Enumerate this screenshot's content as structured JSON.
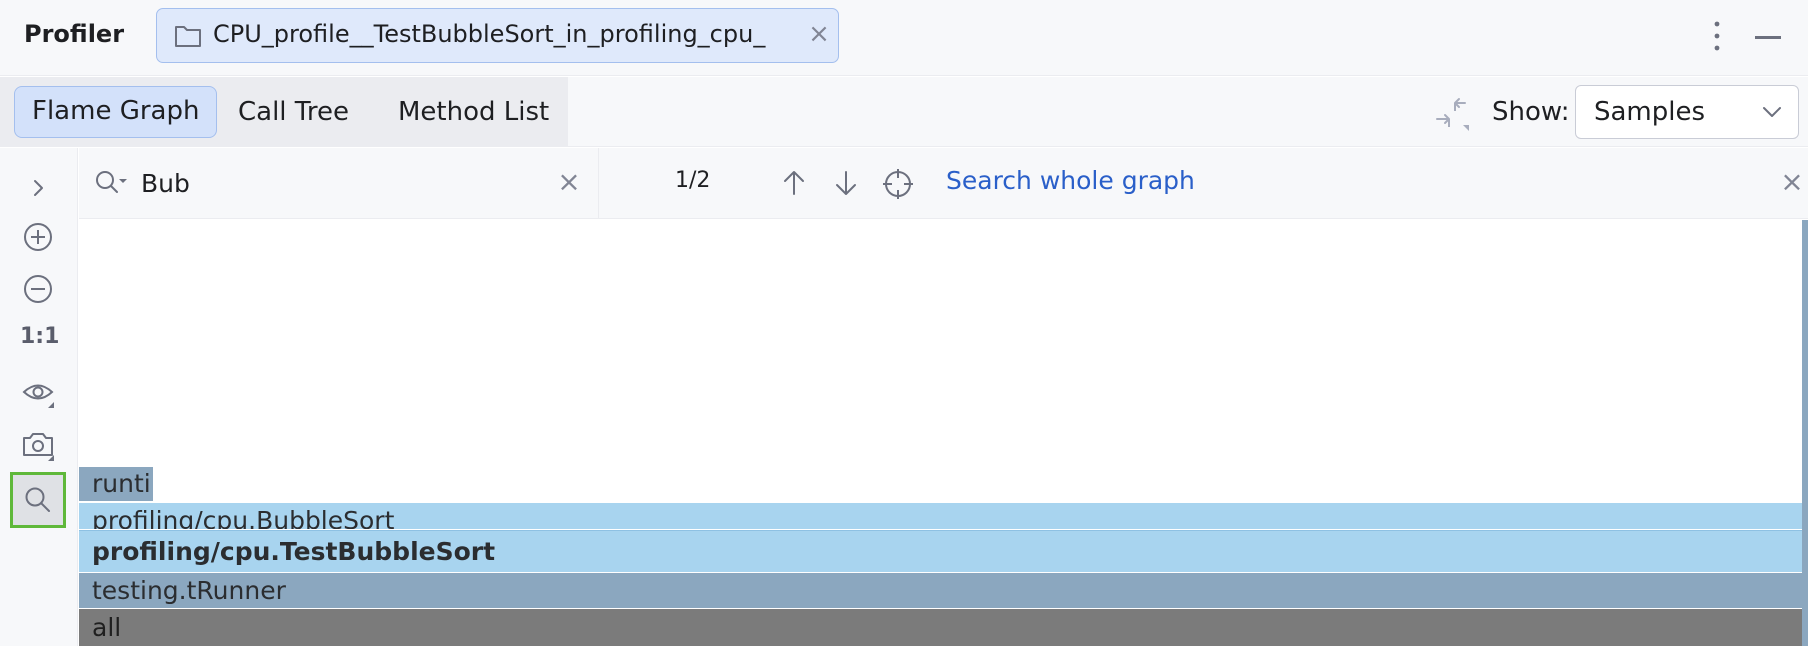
{
  "app": {
    "title": "Profiler",
    "file_tab": {
      "name": "CPU_profile__TestBubbleSort_in_profiling_cpu_",
      "close_glyph": "×",
      "icon": "folder-icon"
    },
    "menu_icon": "more-vertical-icon",
    "minimize_icon": "minimize-icon"
  },
  "toolbar": {
    "tabs": [
      {
        "label": "Flame Graph",
        "active": true
      },
      {
        "label": "Call Tree",
        "active": false
      },
      {
        "label": "Method List",
        "active": false
      }
    ],
    "show_label": "Show:",
    "show_value": "Samples"
  },
  "left_tools": {
    "reset_zoom_label": "1:1",
    "icons": [
      "expand-icon",
      "zoom-in-icon",
      "zoom-out-icon",
      "eye-icon",
      "camera-icon",
      "search-icon"
    ]
  },
  "search": {
    "query": "Bub",
    "match_count": "1/2",
    "search_whole_graph": "Search whole graph",
    "clear_glyph": "×"
  },
  "flame_graph": {
    "frames": [
      {
        "label": "runtir",
        "color": "#8ba7bf"
      },
      {
        "label": "profiling/cpu.BubbleSort",
        "color": "#a8d4ef"
      },
      {
        "label": "profiling/cpu.TestBubbleSort",
        "color": "#a8d4ef",
        "bold": true
      },
      {
        "label": "testing.tRunner",
        "color": "#8ba7bf"
      },
      {
        "label": "all",
        "color": "#7b7b7b"
      }
    ]
  },
  "colors": {
    "accent": "#2a5fc9",
    "active_tab_bg": "#d3e1fa",
    "highlight_border": "#5fb83a"
  }
}
